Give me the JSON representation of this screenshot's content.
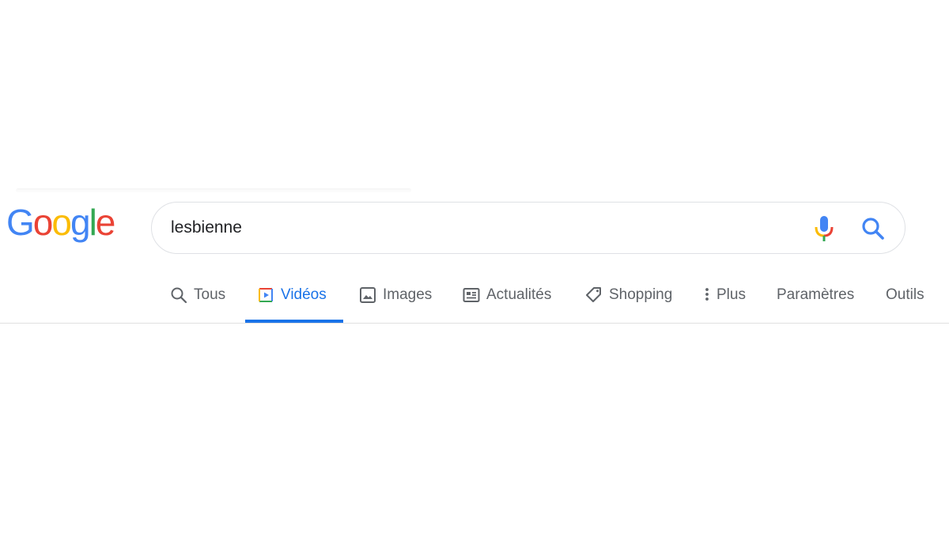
{
  "logo": {
    "letters": [
      "G",
      "o",
      "o",
      "g",
      "l",
      "e"
    ],
    "colors": [
      "#4285F4",
      "#EA4335",
      "#FBBC05",
      "#4285F4",
      "#34A853",
      "#EA4335"
    ]
  },
  "search": {
    "value": "lesbienne",
    "mic_icon": "microphone-icon",
    "search_icon": "search-icon"
  },
  "tabs": [
    {
      "label": "Tous",
      "icon": "search-icon",
      "active": false
    },
    {
      "label": "Vidéos",
      "icon": "video-icon",
      "active": true
    },
    {
      "label": "Images",
      "icon": "image-icon",
      "active": false
    },
    {
      "label": "Actualités",
      "icon": "news-icon",
      "active": false
    },
    {
      "label": "Shopping",
      "icon": "tag-icon",
      "active": false
    },
    {
      "label": "Plus",
      "icon": "more-vert-icon",
      "active": false
    },
    {
      "label": "Paramètres",
      "active": false
    },
    {
      "label": "Outils",
      "active": false
    }
  ],
  "colors": {
    "accent": "#1a73e8",
    "text_muted": "#5f6368",
    "border": "#dfe1e5"
  }
}
